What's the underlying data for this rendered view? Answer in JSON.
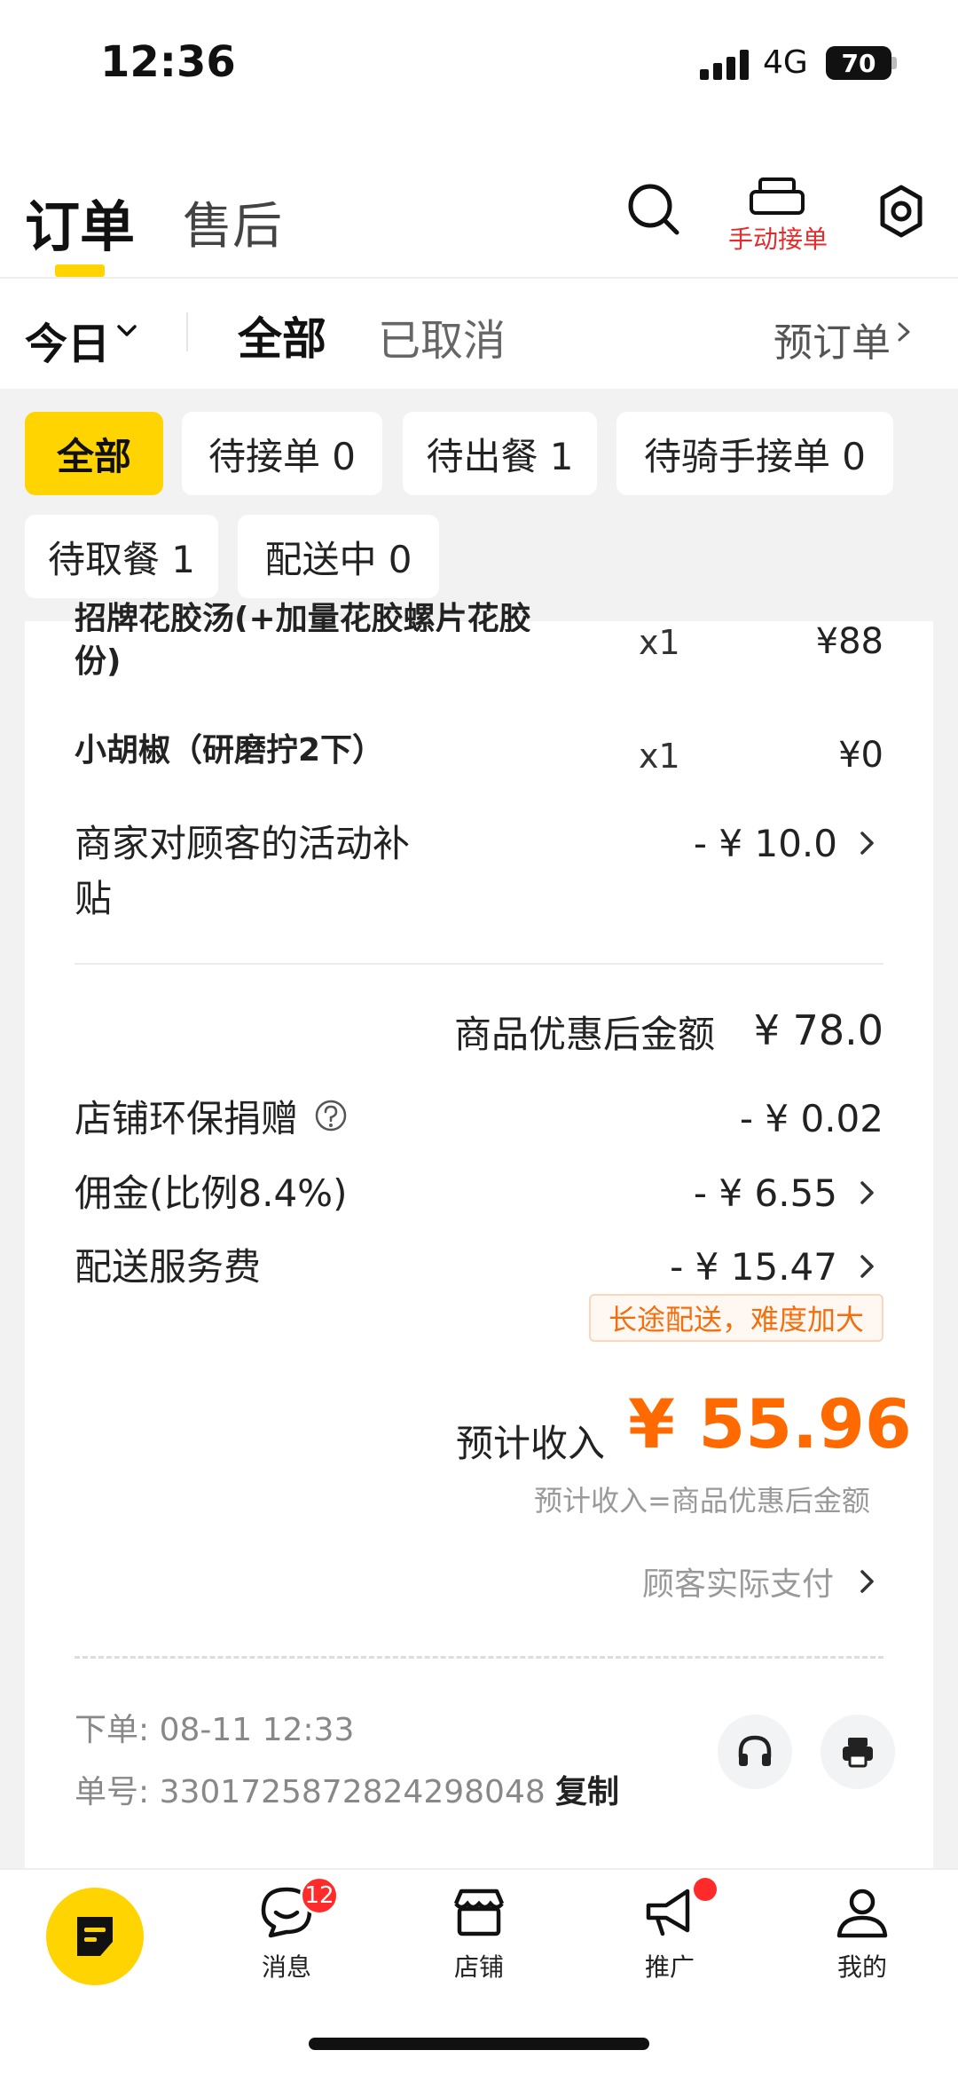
{
  "status_bar": {
    "time": "12:36",
    "network": "4G",
    "battery": "70"
  },
  "header": {
    "tabs": [
      {
        "label": "订单",
        "active": true
      },
      {
        "label": "售后",
        "active": false
      }
    ],
    "manual_accept_label": "手动接单"
  },
  "filters": {
    "date": "今日",
    "tabs": [
      {
        "label": "全部",
        "active": true
      },
      {
        "label": "已取消",
        "active": false
      }
    ],
    "preorder_label": "预订单"
  },
  "status_chips": [
    {
      "label": "全部",
      "active": true
    },
    {
      "label": "待接单 0",
      "active": false
    },
    {
      "label": "待出餐 1",
      "active": false
    },
    {
      "label": "待骑手接单 0",
      "active": false
    },
    {
      "label": "待取餐 1",
      "active": false
    },
    {
      "label": "配送中 0",
      "active": false
    }
  ],
  "items": [
    {
      "name": "招牌花胶汤(+加量花胶螺片花胶",
      "name_line2": "份)",
      "qty": "x1",
      "price": "¥88"
    },
    {
      "name": "小胡椒（研磨拧2下）",
      "qty": "x1",
      "price": "¥0"
    }
  ],
  "subsidy": {
    "label_line1": "商家对顾客的活动补",
    "label_line2": "贴",
    "value": "- ¥ 10.0"
  },
  "after_discount": {
    "label": "商品优惠后金额",
    "value": "¥ 78.0"
  },
  "fees": [
    {
      "label": "店铺环保捐赠",
      "value": "- ¥ 0.02"
    },
    {
      "label": "佣金(比例8.4%)",
      "value": "- ¥ 6.55"
    },
    {
      "label": "配送服务费",
      "value": "- ¥ 15.47"
    }
  ],
  "delivery_notice": "长途配送，难度加大",
  "income": {
    "label": "预计收入",
    "value": "¥ 55.96",
    "formula": "预计收入=商品优惠后金额"
  },
  "customer_paid_label": "顾客实际支付",
  "order_meta": {
    "placed": "下单: 08-11 12:33",
    "number": "单号: 3301725872824298048",
    "copy_label": "复制"
  },
  "bottom_nav": {
    "items": [
      {
        "label": "消息"
      },
      {
        "label": "店铺"
      },
      {
        "label": "推广"
      },
      {
        "label": "我的"
      }
    ],
    "message_badge": "12"
  }
}
